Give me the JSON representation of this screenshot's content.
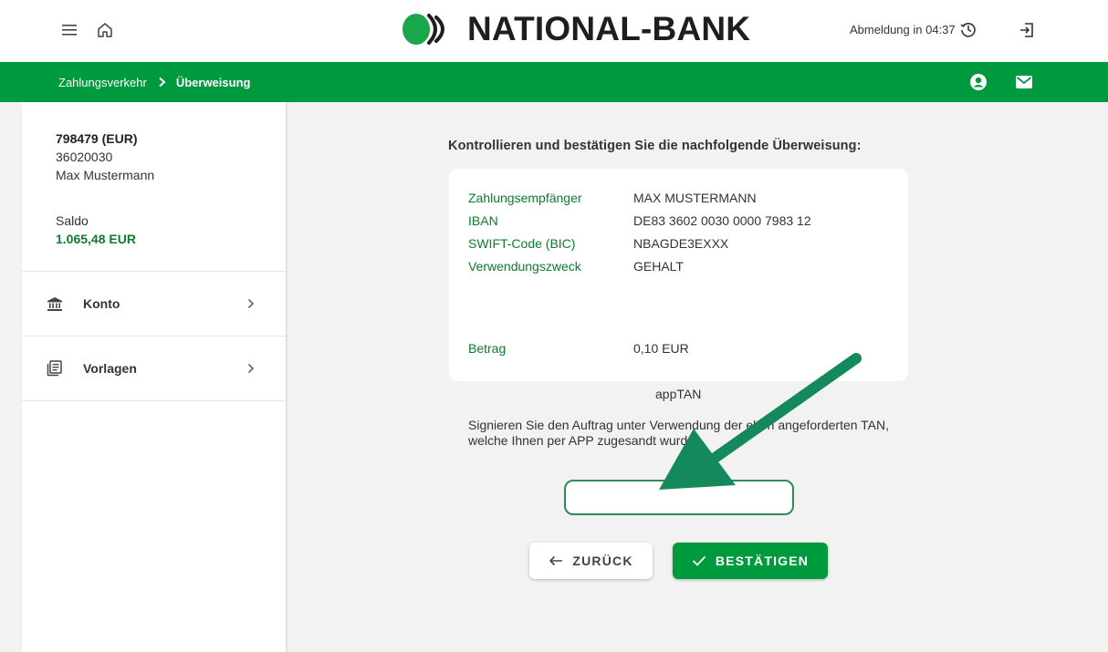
{
  "header": {
    "brand": "NATIONAL-BANK",
    "session_text": "Abmeldung in 04:37"
  },
  "breadcrumb": {
    "parent": "Zahlungsverkehr",
    "current": "Überweisung"
  },
  "sidebar": {
    "account": {
      "number": "798479 (EUR)",
      "blz": "36020030",
      "holder": "Max Mustermann",
      "balance_label": "Saldo",
      "balance_value": "1.065,48 EUR"
    },
    "items": [
      {
        "label": "Konto",
        "icon": "bank-icon"
      },
      {
        "label": "Vorlagen",
        "icon": "templates-icon"
      }
    ]
  },
  "main": {
    "heading": "Kontrollieren und bestätigen Sie die nachfolgende Überweisung:",
    "details": [
      {
        "label": "Zahlungsempfänger",
        "value": "MAX MUSTERMANN"
      },
      {
        "label": "IBAN",
        "value": "DE83 3602 0030 0000 7983 12"
      },
      {
        "label": "SWIFT-Code (BIC)",
        "value": "NBAGDE3EXXX"
      },
      {
        "label": "Verwendungszweck",
        "value": "GEHALT"
      }
    ],
    "amount": {
      "label": "Betrag",
      "value": "0,10 EUR"
    },
    "tan_label": "appTAN",
    "tan_description": "Signieren Sie den Auftrag unter Verwendung der eben angeforderten TAN, welche Ihnen per APP zugesandt wurde.",
    "tan_input_value": "",
    "back_button": "ZURÜCK",
    "confirm_button": "BESTÄTIGEN"
  },
  "colors": {
    "brand_green": "#009a3e",
    "text_green": "#0b7d2f",
    "annotation_arrow": "#148a5c"
  }
}
